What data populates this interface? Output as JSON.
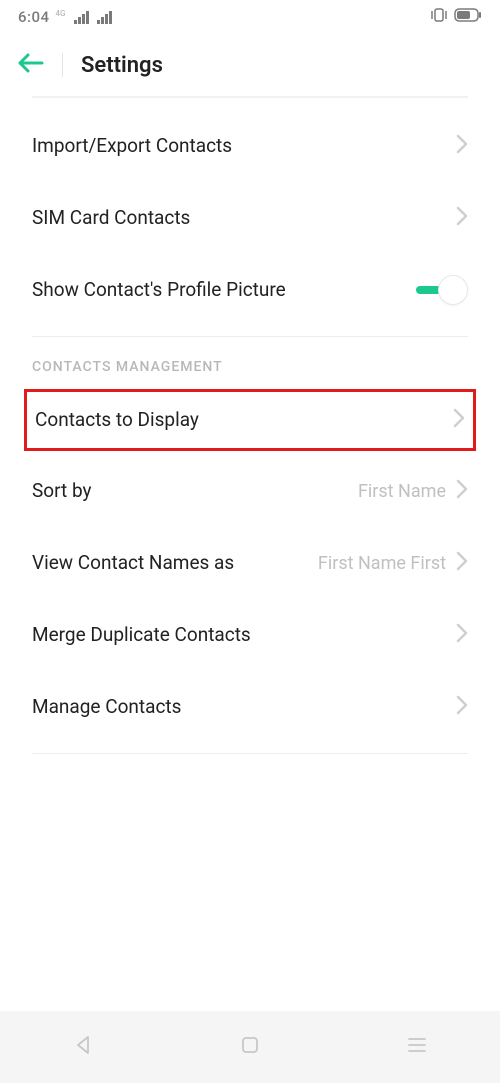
{
  "status": {
    "time": "6:04"
  },
  "header": {
    "title": "Settings"
  },
  "rows": {
    "import_export": "Import/Export Contacts",
    "sim_card": "SIM Card Contacts",
    "profile_picture": "Show Contact's Profile Picture",
    "contacts_to_display": "Contacts to Display",
    "sort_by": "Sort by",
    "sort_by_value": "First Name",
    "view_names_as": "View Contact Names as",
    "view_names_value": "First Name First",
    "merge": "Merge Duplicate Contacts",
    "manage": "Manage Contacts"
  },
  "section": {
    "management": "CONTACTS MANAGEMENT"
  },
  "toggles": {
    "profile_picture_on": true
  }
}
